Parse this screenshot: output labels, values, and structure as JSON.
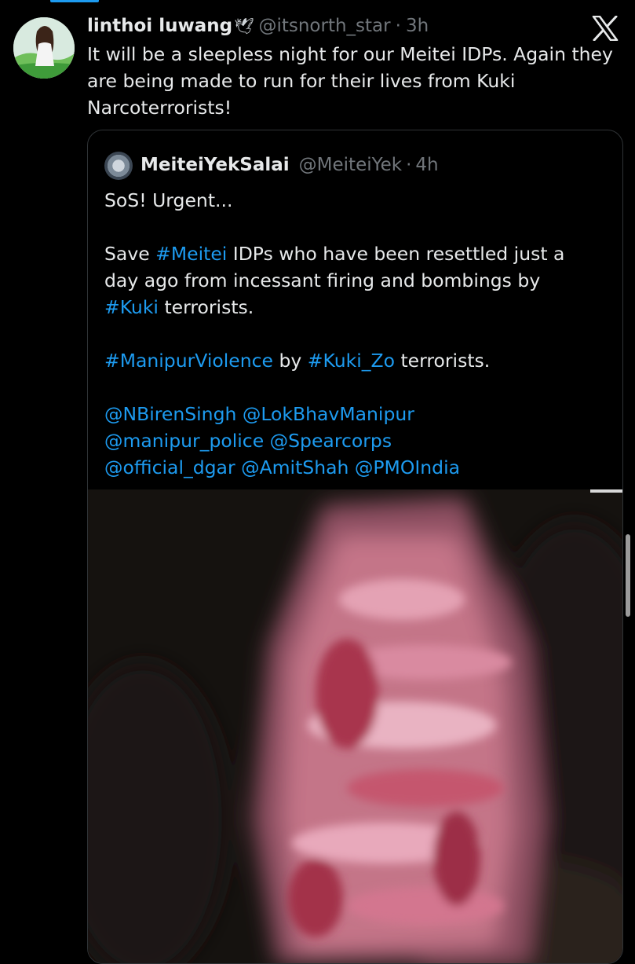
{
  "post": {
    "author_name": "linthoi luwang",
    "author_emoji": "🕊",
    "author_handle": "@itsnorth_star",
    "separator": "·",
    "time": "3h",
    "text": "It will be a sleepless night for our Meitei IDPs. Again they\nare being made to run for their lives from Kuki\nNarcoterrorists!"
  },
  "quote": {
    "author_name": "MeiteiYekSalai",
    "author_handle": "@MeiteiYek",
    "separator": "·",
    "time": "4h",
    "line1": "SoS! Urgent...",
    "line2_pre": "Save ",
    "line2_tag": "#Meitei",
    "line2_post": " IDPs who have been resettled just a",
    "line3": "day ago from incessant firing and bombings by",
    "line4_tag": "#Kuki",
    "line4_post": " terrorists.",
    "line5_tag1": "#ManipurViolence",
    "line5_mid": " by ",
    "line5_tag2": "#Kuki_Zo",
    "line5_post": " terrorists.",
    "mentions_line1": "@NBirenSingh @LokBhavManipur",
    "mentions_line2": "@manipur_police @Spearcorps",
    "mentions_line3": "@official_dgar @AmitShah @PMOIndia"
  },
  "icons": {
    "logo": "x-logo-icon",
    "dove": "dove-emoji"
  },
  "colors": {
    "background": "#000000",
    "text": "#e7e9ea",
    "secondary": "#71767b",
    "link": "#1d9bf0",
    "border": "#2f3336"
  }
}
